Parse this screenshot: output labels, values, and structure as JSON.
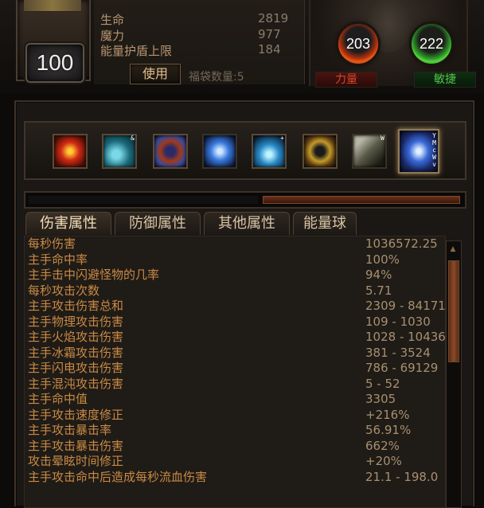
{
  "character": {
    "level": "100"
  },
  "stats": [
    {
      "label": "生命",
      "value": "2819"
    },
    {
      "label": "魔力",
      "value": "977"
    },
    {
      "label": "能量护盾上限",
      "value": "184"
    }
  ],
  "use_button": "使用",
  "bag_count": "福袋数量:5",
  "orbs": {
    "strength": {
      "value": "203",
      "label": "力量",
      "color": "#e85a18"
    },
    "dexterity": {
      "value": "222",
      "label": "敏捷",
      "color": "#54d43a"
    }
  },
  "skills": [
    {
      "icon": "fire-orb-skill-icon",
      "tag": ""
    },
    {
      "icon": "frost-creature-skill-icon",
      "tag": "&"
    },
    {
      "icon": "arcane-ring-skill-icon",
      "tag": ""
    },
    {
      "icon": "lightning-spirit-skill-icon",
      "tag": ""
    },
    {
      "icon": "ice-burst-skill-icon",
      "tag": "+"
    },
    {
      "icon": "golden-ring-skill-icon",
      "tag": ""
    },
    {
      "icon": "wolf-skill-icon",
      "tag": "W"
    },
    {
      "icon": "storm-orb-skill-icon",
      "tags": [
        "Y",
        "M",
        "c",
        "W",
        "v"
      ]
    }
  ],
  "tabs": [
    {
      "label": "伤害属性",
      "active": true
    },
    {
      "label": "防御属性",
      "active": false
    },
    {
      "label": "其他属性",
      "active": false
    },
    {
      "label": "能量球",
      "active": false
    }
  ],
  "damage_stats": [
    {
      "label": "每秒伤害",
      "value": "1036572.25"
    },
    {
      "label": "主手命中率",
      "value": "100%"
    },
    {
      "label": "主手击中闪避怪物的几率",
      "value": "94%"
    },
    {
      "label": "每秒攻击次数",
      "value": "5.71"
    },
    {
      "label": "主手攻击伤害总和",
      "value": "2309 - 84171"
    },
    {
      "label": "主手物理攻击伤害",
      "value": "109 - 1030"
    },
    {
      "label": "主手火焰攻击伤害",
      "value": "1028 - 10436"
    },
    {
      "label": "主手冰霜攻击伤害",
      "value": "381 - 3524"
    },
    {
      "label": "主手闪电攻击伤害",
      "value": "786 - 69129"
    },
    {
      "label": "主手混沌攻击伤害",
      "value": "5 - 52"
    },
    {
      "label": "主手命中值",
      "value": "3305"
    },
    {
      "label": "主手攻击速度修正",
      "value": "+216%"
    },
    {
      "label": "主手攻击暴击率",
      "value": "56.91%"
    },
    {
      "label": "主手攻击暴击伤害",
      "value": "662%"
    },
    {
      "label": "攻击晕眩时间修正",
      "value": "+20%"
    },
    {
      "label": "主手攻击命中后造成每秒流血伤害",
      "value": "21.1 - 198.0"
    }
  ]
}
